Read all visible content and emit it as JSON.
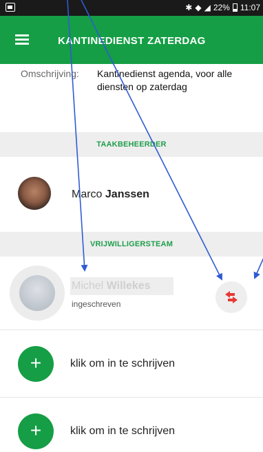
{
  "status_bar": {
    "battery": "22%",
    "time": "11:07"
  },
  "app_bar": {
    "title": "KANTINEDIENST ZATERDAG"
  },
  "description": {
    "label": "Omschrijving:",
    "value": "Kantinedienst agenda, voor alle diensten op zaterdag"
  },
  "manager_section": {
    "header": "TAAKBEHEERDER",
    "first_name": "Marco",
    "last_name": "Janssen"
  },
  "volunteer_section": {
    "header": "VRIJWILLIGERSTEAM",
    "volunteer": {
      "first_name": "Michel",
      "last_name": "Willekes",
      "status": "ingeschreven"
    },
    "signup_slots": [
      {
        "label": "klik om in te schrijven",
        "button": "+"
      },
      {
        "label": "klik om in te schrijven",
        "button": "+"
      }
    ]
  },
  "colors": {
    "primary": "#159e45",
    "swap_icon": "#e53935",
    "annotation": "#2f5bd3"
  }
}
